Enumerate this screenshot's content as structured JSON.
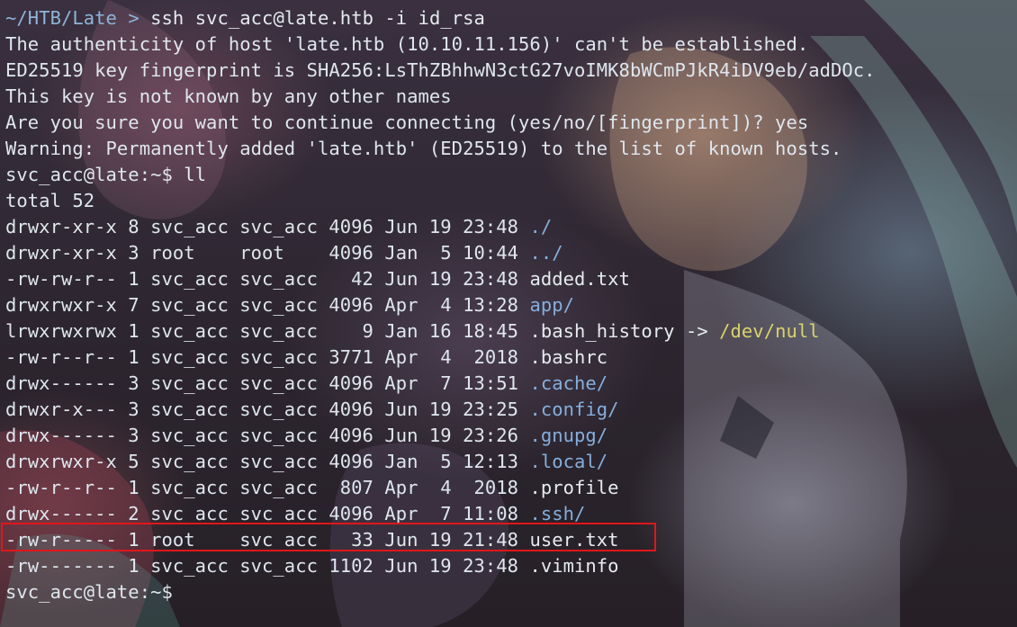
{
  "terminal": {
    "prompt_path": "~/HTB/Late",
    "prompt_arrow": ">",
    "first_command": "ssh svc_acc@late.htb -i id_rsa",
    "ssh_messages": [
      "The authenticity of host 'late.htb (10.10.11.156)' can't be established.",
      "ED25519 key fingerprint is SHA256:LsThZBhhwN3ctG27voIMK8bWCmPJkR4iDV9eb/adDOc.",
      "This key is not known by any other names",
      "Are you sure you want to continue connecting (yes/no/[fingerprint])? yes",
      "Warning: Permanently added 'late.htb' (ED25519) to the list of known hosts."
    ],
    "remote_prompt": "svc_acc@late:~$",
    "second_command": "ll",
    "total_line": "total 52",
    "listing": [
      {
        "meta": "drwxr-xr-x 8 svc_acc svc_acc 4096 Jun 19 23:48 ",
        "name": "./",
        "kind": "dir"
      },
      {
        "meta": "drwxr-xr-x 3 root    root    4096 Jan  5 10:44 ",
        "name": "../",
        "kind": "dir"
      },
      {
        "meta": "-rw-rw-r-- 1 svc_acc svc_acc   42 Jun 19 23:48 ",
        "name": "added.txt",
        "kind": "file"
      },
      {
        "meta": "drwxrwxr-x 7 svc_acc svc_acc 4096 Apr  4 13:28 ",
        "name": "app/",
        "kind": "dir"
      },
      {
        "meta": "lrwxrwxrwx 1 svc_acc svc_acc    9 Jan 16 18:45 ",
        "name": ".bash_history",
        "arrow": " -> ",
        "target": "/dev/null",
        "kind": "link"
      },
      {
        "meta": "-rw-r--r-- 1 svc_acc svc_acc 3771 Apr  4  2018 ",
        "name": ".bashrc",
        "kind": "file"
      },
      {
        "meta": "drwx------ 3 svc_acc svc_acc 4096 Apr  7 13:51 ",
        "name": ".cache/",
        "kind": "dir"
      },
      {
        "meta": "drwxr-x--- 3 svc_acc svc_acc 4096 Jun 19 23:25 ",
        "name": ".config/",
        "kind": "dir"
      },
      {
        "meta": "drwx------ 3 svc_acc svc_acc 4096 Jun 19 23:26 ",
        "name": ".gnupg/",
        "kind": "dir"
      },
      {
        "meta": "drwxrwxr-x 5 svc_acc svc_acc 4096 Jan  5 12:13 ",
        "name": ".local/",
        "kind": "dir"
      },
      {
        "meta": "-rw-r--r-- 1 svc_acc svc_acc  807 Apr  4  2018 ",
        "name": ".profile",
        "kind": "file"
      },
      {
        "meta": "drwx------ 2 svc_acc svc_acc 4096 Apr  7 11:08 ",
        "name": ".ssh/",
        "kind": "dir"
      },
      {
        "meta": "-rw-r----- 1 root    svc_acc   33 Jun 19 21:48 ",
        "name": "user.txt",
        "kind": "file"
      },
      {
        "meta": "-rw------- 1 svc_acc svc_acc 1102 Jun 19 23:48 ",
        "name": ".viminfo",
        "kind": "file"
      }
    ],
    "final_prompt": "svc_acc@late:~$",
    "colors": {
      "path": "#8fb4d8",
      "directory": "#86aedc",
      "symlink_target": "#d9d36a",
      "highlight_border": "#e0161b"
    }
  }
}
